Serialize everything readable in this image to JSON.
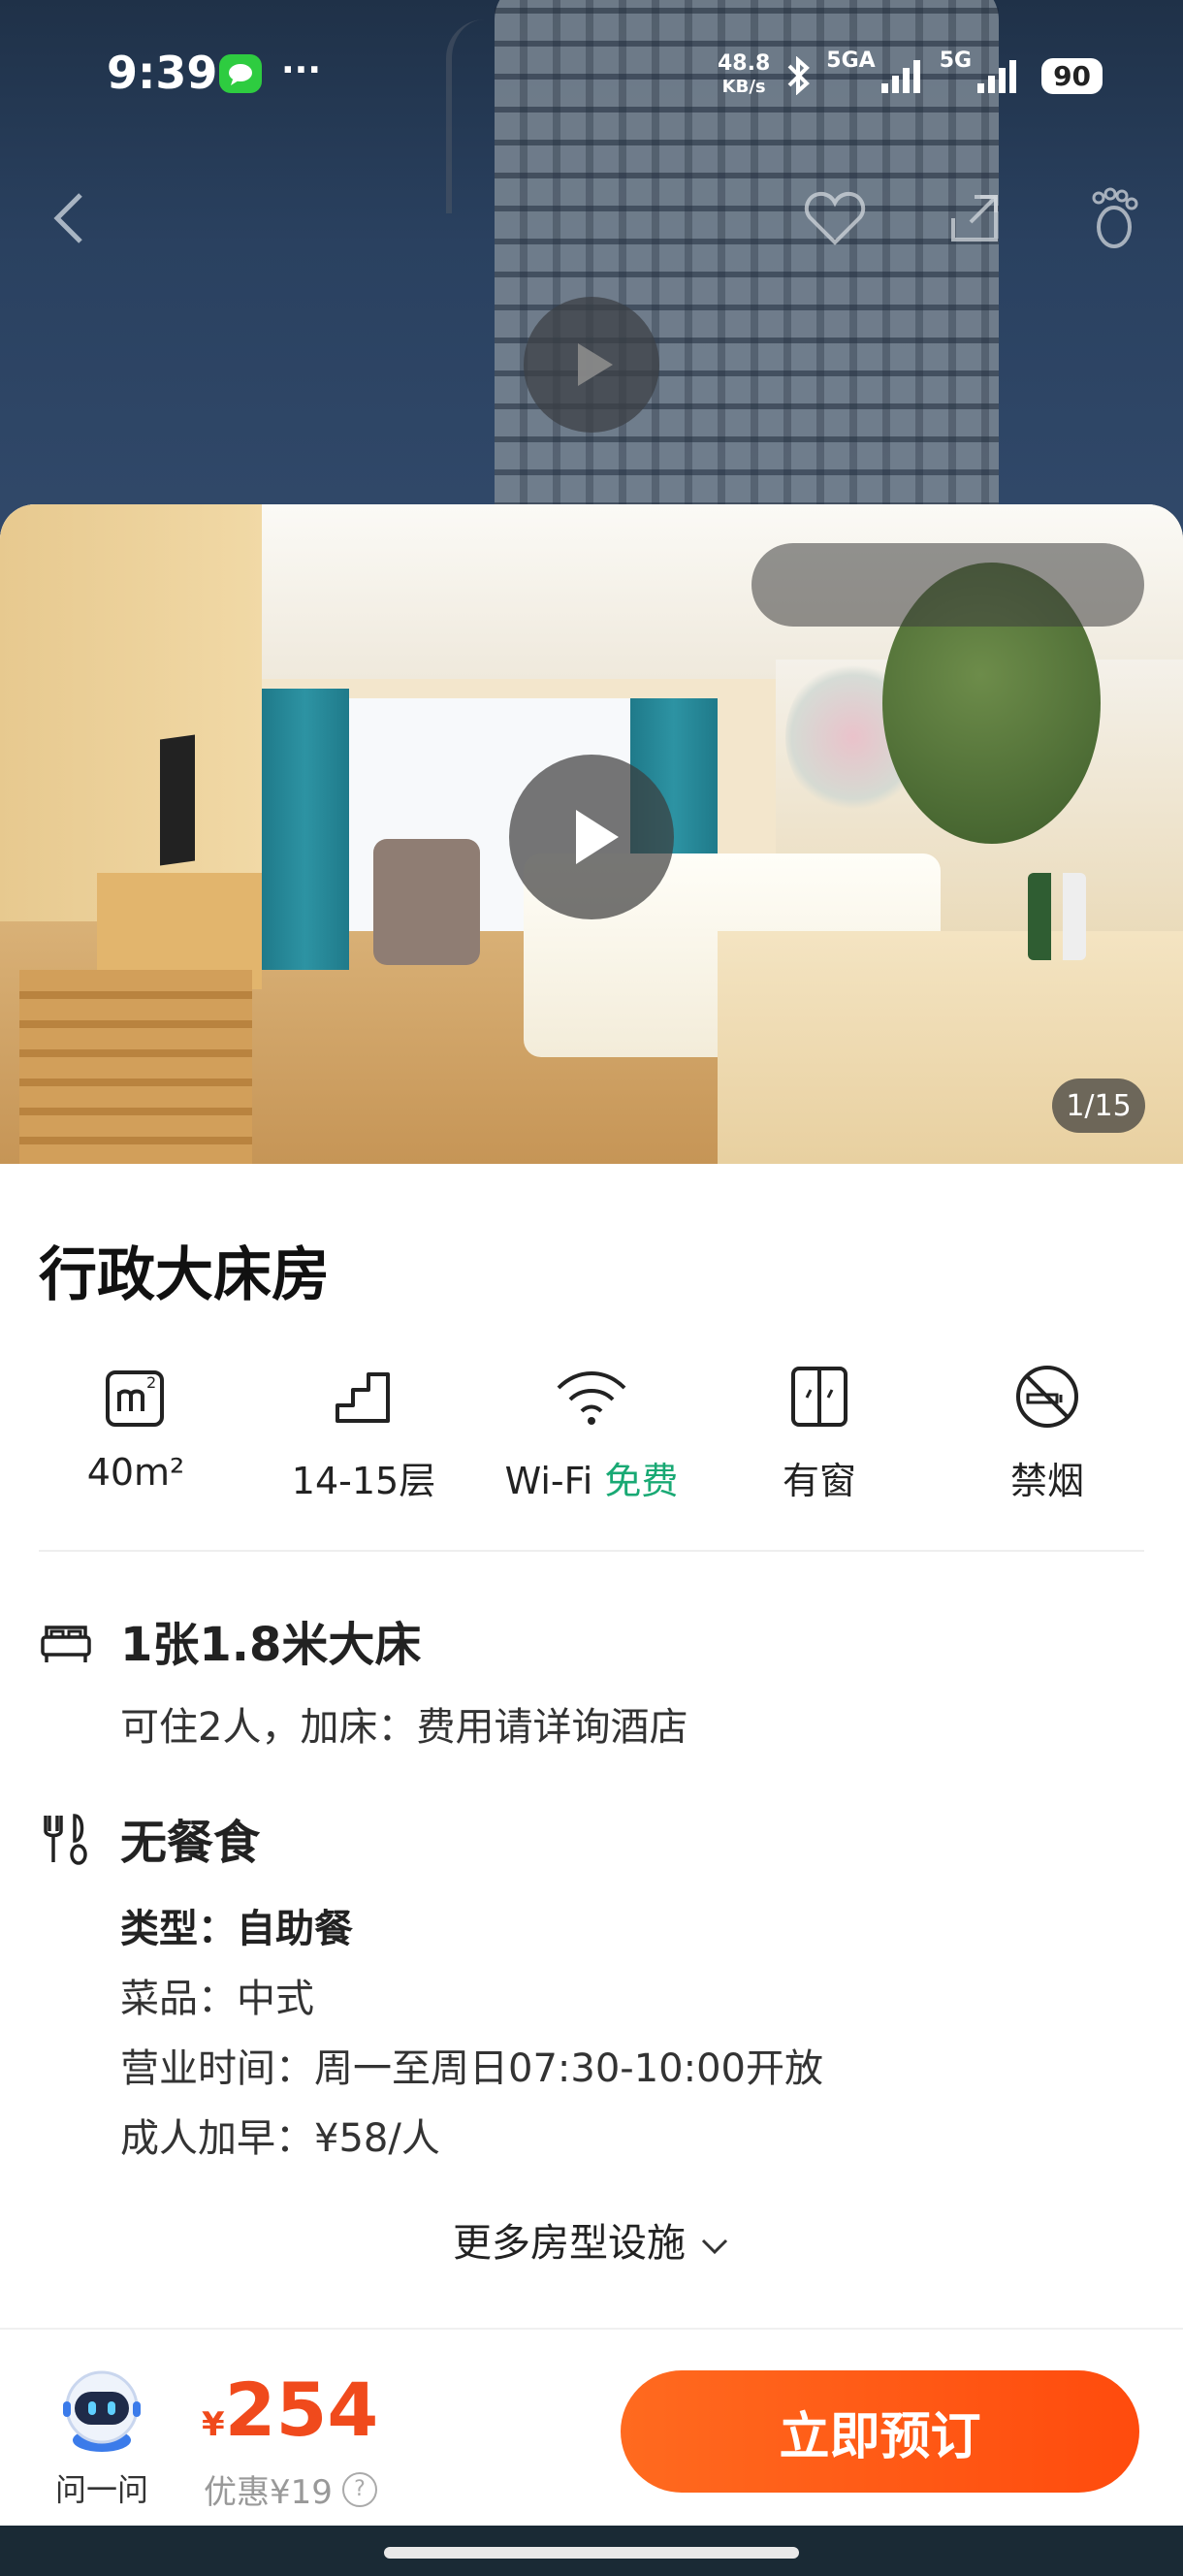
{
  "status_bar": {
    "time": "9:39",
    "dots": "···",
    "net_speed_value": "48.8",
    "net_speed_unit": "KB/s",
    "signal_1_label": "5GA",
    "signal_2_label": "5G",
    "battery": "90"
  },
  "nav": {
    "icons": [
      "back-icon",
      "heart-icon",
      "share-icon",
      "footprint-icon"
    ]
  },
  "gallery": {
    "counter": "1/15"
  },
  "room": {
    "title": "行政大床房",
    "facilities": [
      {
        "icon": "area-icon",
        "label": "40m²"
      },
      {
        "icon": "floor-icon",
        "label": "14-15层"
      },
      {
        "icon": "wifi-icon",
        "label": "Wi-Fi",
        "extra": "免费"
      },
      {
        "icon": "window-icon",
        "label": "有窗"
      },
      {
        "icon": "no-smoking-icon",
        "label": "禁烟"
      }
    ],
    "bed": {
      "title": "1张1.8米大床",
      "detail": "可住2人，加床：费用请详询酒店"
    },
    "meal": {
      "title": "无餐食",
      "type": "类型：自助餐",
      "cuisine": "菜品：中式",
      "hours": "营业时间：周一至周日07:30-10:00开放",
      "adult_extra": "成人加早：¥58/人"
    },
    "more_link": "更多房型设施"
  },
  "bottom_bar": {
    "assistant_label": "问一问",
    "currency": "¥",
    "price": "254",
    "discount": "优惠¥19",
    "help_symbol": "?",
    "book_button": "立即预订"
  },
  "colors": {
    "accent_orange": "#ff5a14",
    "price_red": "#f04a1c",
    "free_green": "#19a974"
  }
}
